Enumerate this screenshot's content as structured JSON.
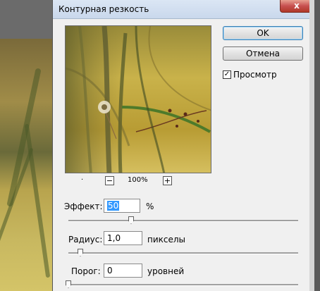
{
  "dialog": {
    "title": "Контурная резкость",
    "close_label": "x",
    "ok_label": "OK",
    "cancel_label": "Отмена",
    "preview_checkbox": {
      "label": "Просмотр",
      "checked": true,
      "mark": "✓"
    }
  },
  "preview": {
    "zoom": "100%",
    "zoom_out_label": "−",
    "zoom_in_label": "+",
    "dot": "·"
  },
  "params": {
    "amount": {
      "label": "Эффект:",
      "value": "50",
      "unit": "%",
      "slider_fraction": 0.27
    },
    "radius": {
      "label": "Радиус:",
      "value": "1,0",
      "unit": "пикселы",
      "slider_fraction": 0.05
    },
    "threshold": {
      "label": "Порог:",
      "value": "0",
      "unit": "уровней",
      "slider_fraction": 0.0
    }
  },
  "colors": {
    "selection": "#3399ff",
    "close_button": "#c75050",
    "titlebar": "#c9d8ec"
  },
  "icons": {
    "close": "close-icon",
    "checkbox": "checkmark-icon"
  }
}
